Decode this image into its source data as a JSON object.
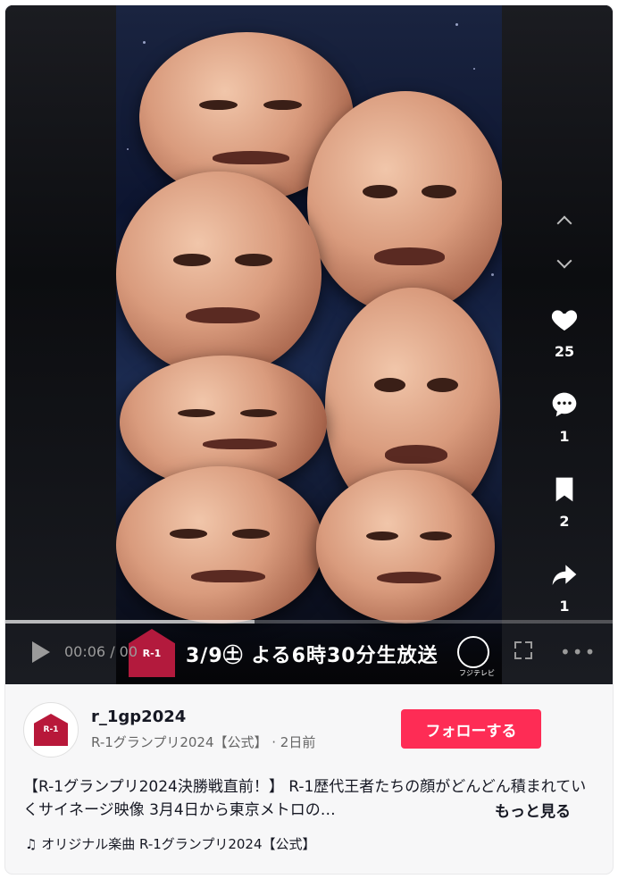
{
  "video": {
    "banner_logo": "R-1",
    "banner_text": "3/9㊏ よる6時30分生放送",
    "banner_channel": "フジテレビ",
    "time_current": "00:06",
    "time_separator": " / 00",
    "progress": 0.41
  },
  "actions": {
    "likes": "25",
    "comments": "1",
    "saves": "2",
    "shares": "1"
  },
  "account": {
    "username": "r_1gp2024",
    "display_name": "R-1グランプリ2024【公式】",
    "posted": " · 2日前",
    "avatar_text": "R-1",
    "follow_label": "フォローする"
  },
  "caption": {
    "text": "【R-1グランプリ2024決勝戦直前！】 R-1歴代王者たちの顔がどんどん積まれていくサイネージ映像 3月4日から東京メトロの…",
    "more_label": "もっと見る"
  },
  "music": {
    "icon": "♫",
    "label": "オリジナル楽曲 R-1グランプリ2024【公式】"
  },
  "colors": {
    "accent": "#fe2c55",
    "card_bg": "#f7f7f8",
    "player_bg": "#0b0b0d"
  }
}
